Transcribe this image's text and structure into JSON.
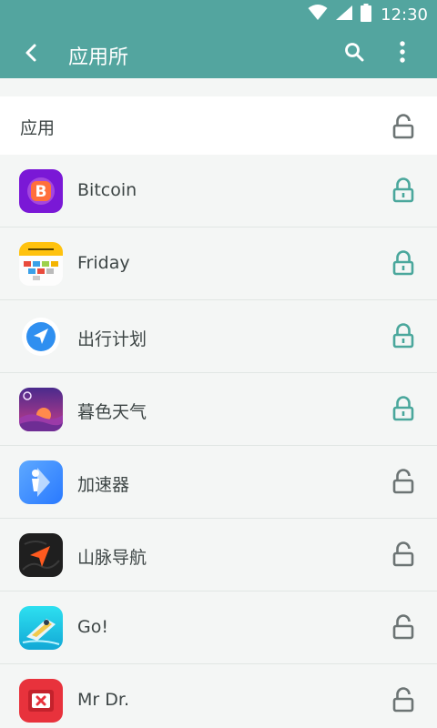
{
  "status_bar": {
    "time": "12:30",
    "icons": [
      "wifi-icon",
      "cellular-signal-icon",
      "battery-icon"
    ]
  },
  "app_bar": {
    "title": "应用所",
    "back_icon": "chevron-left-icon",
    "search_icon": "search-icon",
    "more_icon": "more-vertical-icon"
  },
  "section": {
    "title": "应用",
    "lock_state": "unlocked"
  },
  "apps": [
    {
      "name": "Bitcoin",
      "icon": "bitcoin-app-icon",
      "locked": true
    },
    {
      "name": "Friday",
      "icon": "friday-app-icon",
      "locked": true
    },
    {
      "name": "出行计划",
      "icon": "travel-plan-app-icon",
      "locked": true
    },
    {
      "name": "暮色天气",
      "icon": "twilight-weather-app-icon",
      "locked": true
    },
    {
      "name": "加速器",
      "icon": "accelerator-app-icon",
      "locked": false
    },
    {
      "name": "山脉导航",
      "icon": "mountain-navigation-app-icon",
      "locked": false
    },
    {
      "name": "Go!",
      "icon": "go-app-icon",
      "locked": false
    },
    {
      "name": "Mr Dr.",
      "icon": "mr-dr-app-icon",
      "locked": false
    }
  ],
  "colors": {
    "header": "#53a59f",
    "locked": "#4aa79c",
    "unlocked": "#6c7474",
    "text": "#3d4545"
  }
}
